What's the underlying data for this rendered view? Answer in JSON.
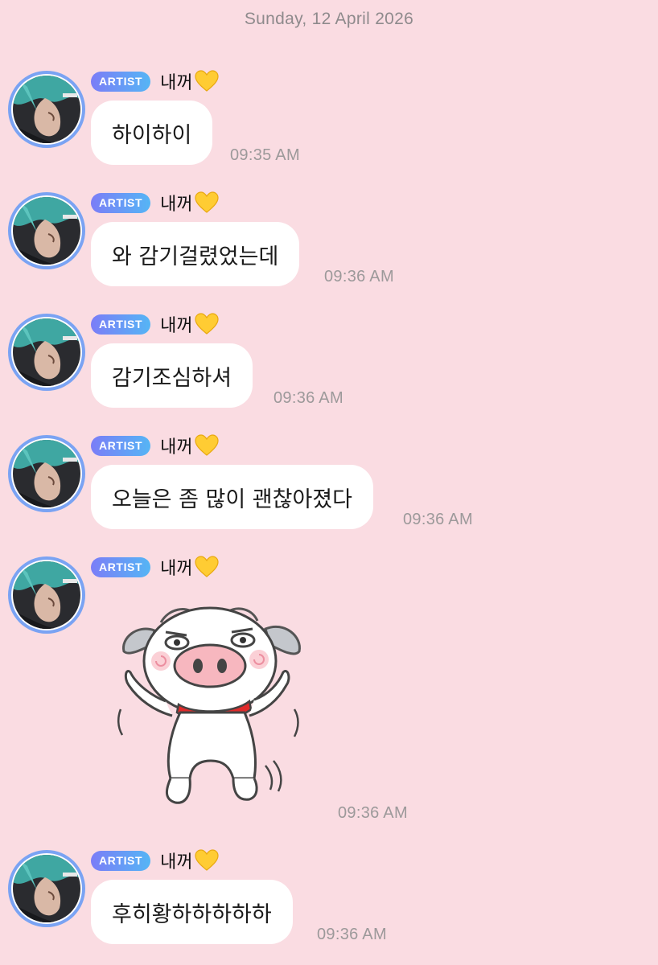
{
  "date_header": "Sunday, 12 April 2026",
  "sender": {
    "badge": "ARTIST",
    "name": "내꺼",
    "name_emoji": "yellow-heart-icon"
  },
  "colors": {
    "background": "#fadce2",
    "badge_gradient_start": "#7b7df7",
    "badge_gradient_end": "#55b5f5",
    "avatar_ring": "#7aa3f3",
    "bubble": "#ffffff",
    "timestamp": "#9c999a"
  },
  "messages": [
    {
      "type": "text",
      "text": "하이하이",
      "time": "09:35 AM"
    },
    {
      "type": "text",
      "text": "와 감기걸렸었는데",
      "time": "09:36 AM"
    },
    {
      "type": "text",
      "text": "감기조심하셔",
      "time": "09:36 AM"
    },
    {
      "type": "text",
      "text": "오늘은 좀 많이 괜찮아졌다",
      "time": "09:36 AM"
    },
    {
      "type": "sticker",
      "sticker": "dancing-pig-sticker",
      "time": "09:36 AM"
    },
    {
      "type": "text",
      "text": "후히황하하하하하",
      "time": "09:36 AM"
    }
  ]
}
